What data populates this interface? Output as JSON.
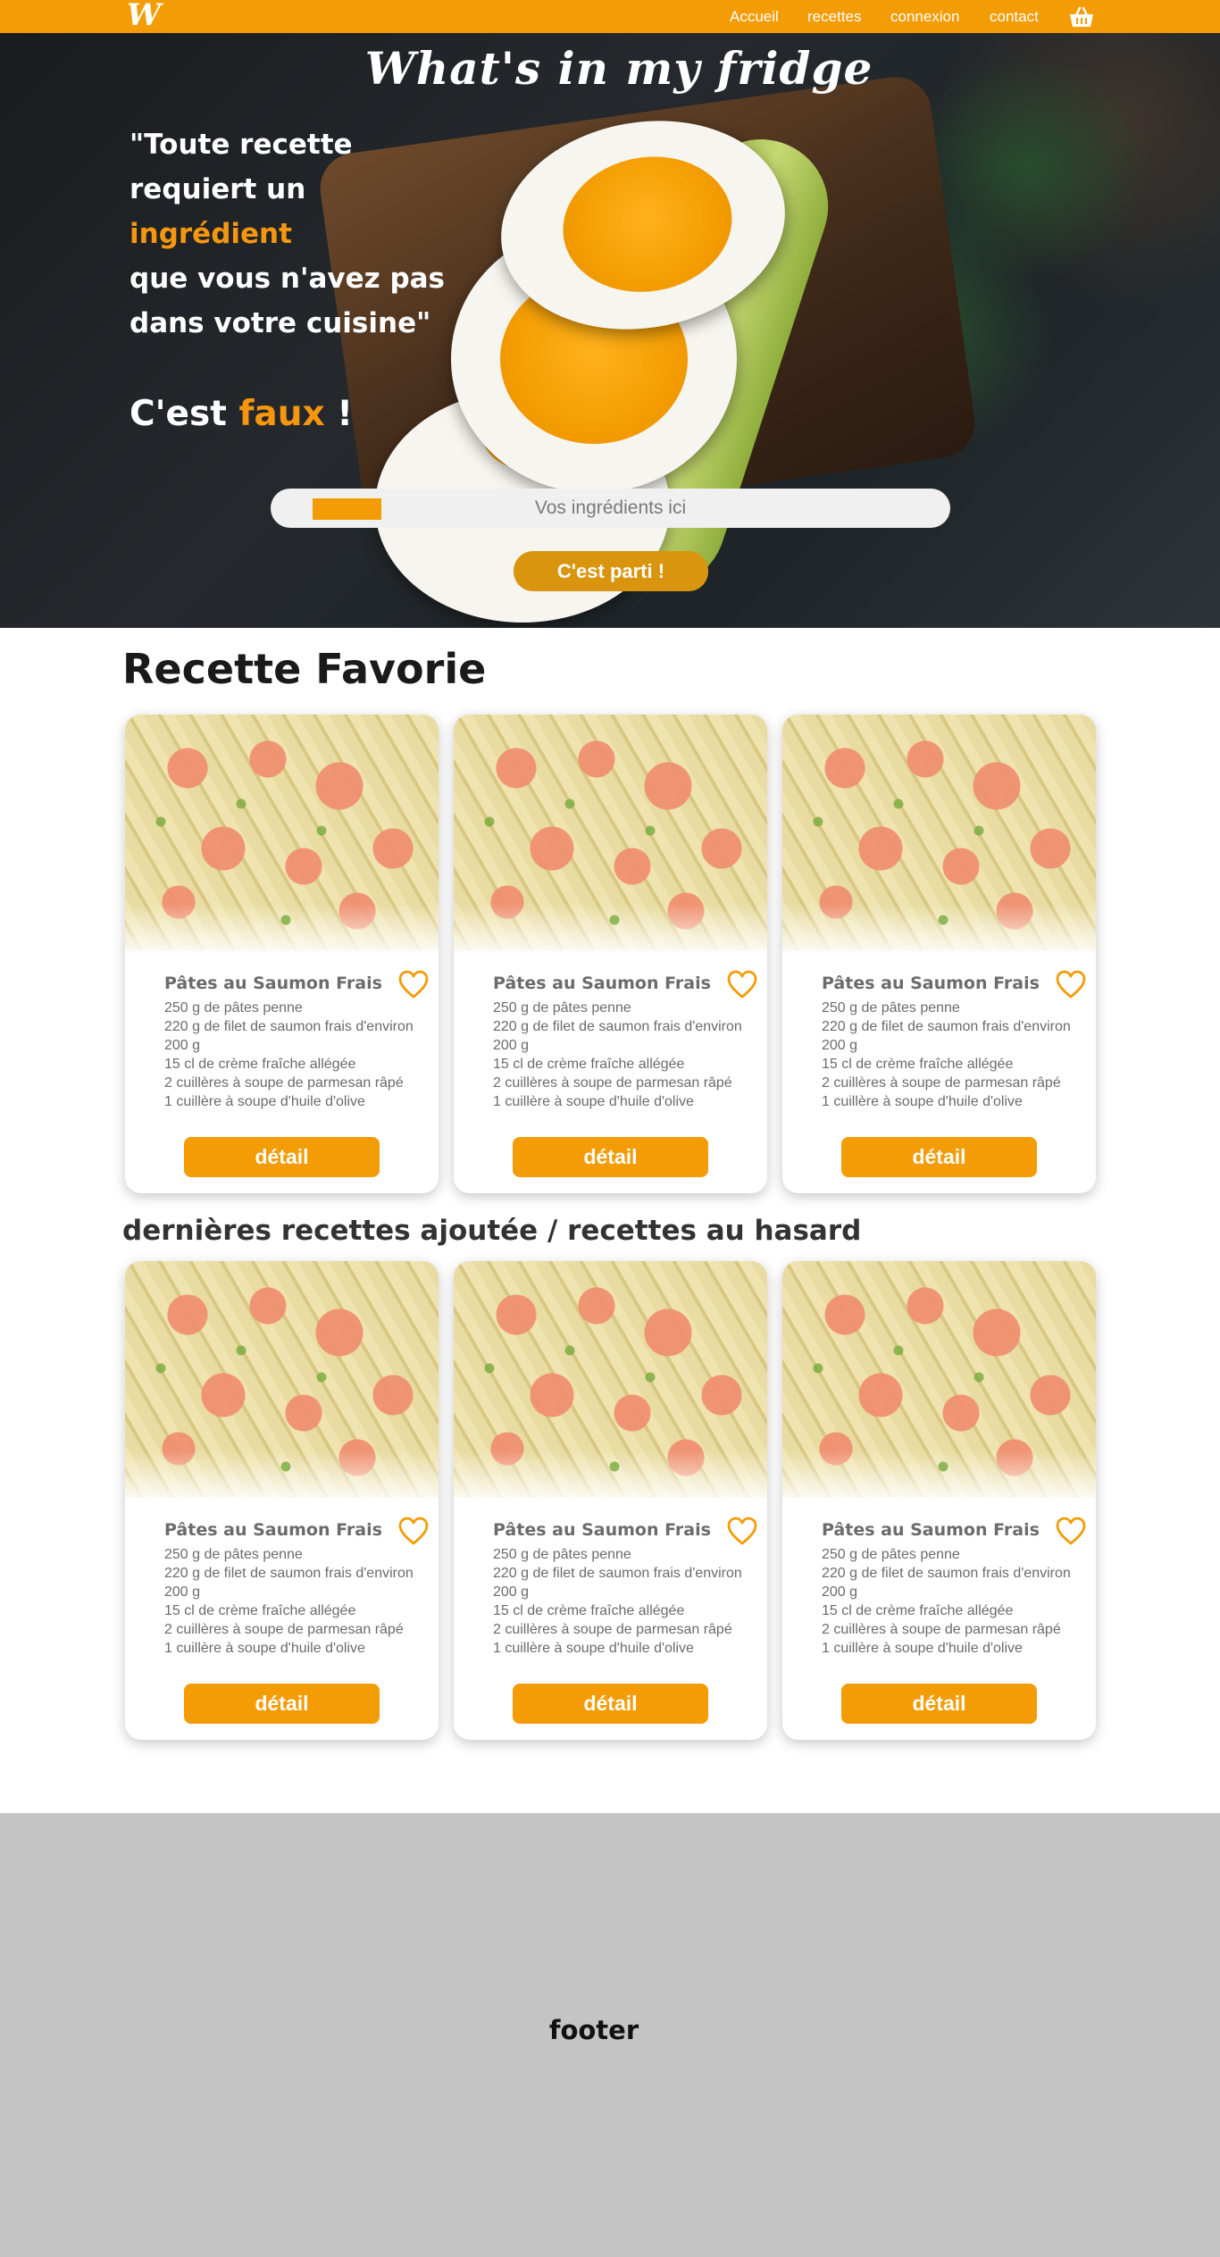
{
  "nav": {
    "logo": "W",
    "links": [
      "Accueil",
      "recettes",
      "connexion",
      "contact"
    ],
    "basket_icon": "basket-icon"
  },
  "hero": {
    "title": "What's in my fridge",
    "quote_line1": "\"Toute recette",
    "quote_line2": "requiert un",
    "quote_accent": "ingrédient",
    "quote_line4": "que vous n'avez pas",
    "quote_line5": "dans votre cuisine\"",
    "claim_prefix": "C'est",
    "claim_accent": "faux",
    "claim_suffix": "!",
    "search_placeholder": "Vos ingrédients ici",
    "button": "C'est parti !"
  },
  "colors": {
    "accent": "#f39c06",
    "accent_text": "#f5960f",
    "footer_bg": "#c4c4c4"
  },
  "favorites": {
    "title": "Recette Favorie",
    "cards": [
      {
        "name": "Pâtes au Saumon Frais",
        "ingredients": [
          "250 g de pâtes penne",
          "220 g de filet de saumon frais d'environ 200 g",
          "15 cl de crème fraîche allégée",
          "2 cuillères à soupe de parmesan râpé",
          "1 cuillère à soupe d'huile d'olive"
        ],
        "button": "détail"
      },
      {
        "name": "Pâtes au Saumon Frais",
        "ingredients": [
          "250 g de pâtes penne",
          "220 g de filet de saumon frais d'environ 200 g",
          "15 cl de crème fraîche allégée",
          "2 cuillères à soupe de parmesan râpé",
          "1 cuillère à soupe d'huile d'olive"
        ],
        "button": "détail"
      },
      {
        "name": "Pâtes au Saumon Frais",
        "ingredients": [
          "250 g de pâtes penne",
          "220 g de filet de saumon frais d'environ 200 g",
          "15 cl de crème fraîche allégée",
          "2 cuillères à soupe de parmesan râpé",
          "1 cuillère à soupe d'huile d'olive"
        ],
        "button": "détail"
      }
    ]
  },
  "latest": {
    "title": "dernières recettes ajoutée / recettes au hasard",
    "cards": [
      {
        "name": "Pâtes au Saumon Frais",
        "ingredients": [
          "250 g de pâtes penne",
          "220 g de filet de saumon frais d'environ 200 g",
          "15 cl de crème fraîche allégée",
          "2 cuillères à soupe de parmesan râpé",
          "1 cuillère à soupe d'huile d'olive"
        ],
        "button": "détail"
      },
      {
        "name": "Pâtes au Saumon Frais",
        "ingredients": [
          "250 g de pâtes penne",
          "220 g de filet de saumon frais d'environ 200 g",
          "15 cl de crème fraîche allégée",
          "2 cuillères à soupe de parmesan râpé",
          "1 cuillère à soupe d'huile d'olive"
        ],
        "button": "détail"
      },
      {
        "name": "Pâtes au Saumon Frais",
        "ingredients": [
          "250 g de pâtes penne",
          "220 g de filet de saumon frais d'environ 200 g",
          "15 cl de crème fraîche allégée",
          "2 cuillères à soupe de parmesan râpé",
          "1 cuillère à soupe d'huile d'olive"
        ],
        "button": "détail"
      }
    ]
  },
  "footer": {
    "label": "footer"
  }
}
